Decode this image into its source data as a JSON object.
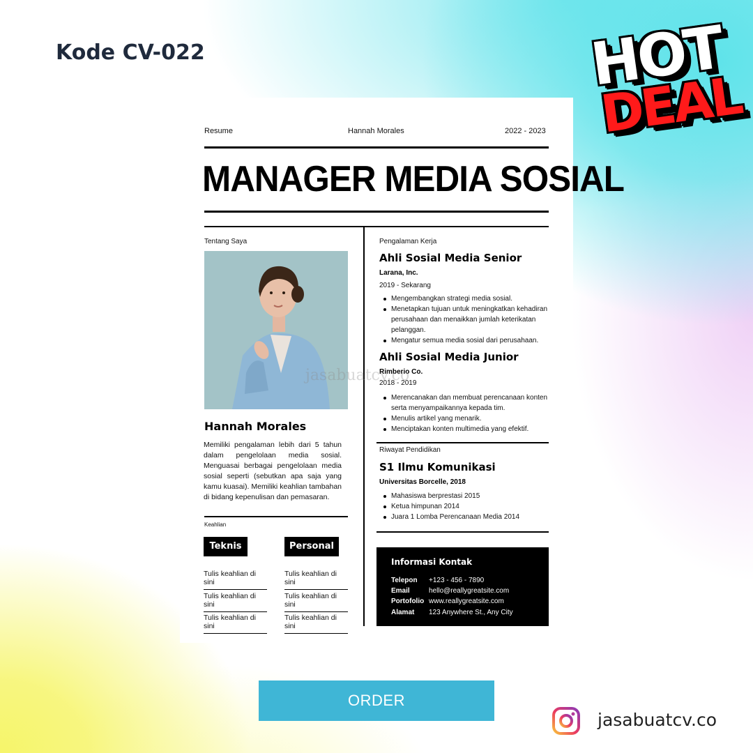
{
  "header": {
    "code": "Kode CV-022"
  },
  "badge": {
    "hot": "HOT",
    "deal": "DEAL"
  },
  "resume": {
    "top_left": "Resume",
    "top_center": "Hannah Morales",
    "top_right": "2022 - 2023",
    "title": "MANAGER MEDIA SOSIAL",
    "about_label": "Tentang Saya",
    "name": "Hannah Morales",
    "about_text": "Memiliki pengalaman lebih dari 5 tahun dalam pengelolaan media sosial. Menguasai berbagai pengelolaan media sosial seperti (sebutkan apa saja yang kamu kuasai). Memiliki keahlian tambahan di bidang kepenulisan dan pemasaran.",
    "skills_label": "Keahlian",
    "skills": {
      "technical_label": "Teknis",
      "personal_label": "Personal",
      "technical_items": [
        "Tulis keahlian di sini",
        "Tulis keahlian di sini",
        "Tulis keahlian di sini"
      ],
      "personal_items": [
        "Tulis keahlian di sini",
        "Tulis keahlian di sini",
        "Tulis keahlian di sini"
      ]
    },
    "experience_label": "Pengalaman Kerja",
    "jobs": [
      {
        "title": "Ahli Sosial Media Senior",
        "company": "Larana, Inc.",
        "period": "2019 - Sekarang",
        "bullets": [
          "Mengembangkan strategi media sosial.",
          "Menetapkan tujuan untuk meningkatkan kehadiran perusahaan dan menaikkan jumlah keterikatan pelanggan.",
          "Mengatur semua media sosial dari perusahaan."
        ]
      },
      {
        "title": "Ahli Sosial Media Junior",
        "company": "Rimberio Co.",
        "period": "2018 - 2019",
        "bullets": [
          "Merencanakan dan membuat perencanaan konten serta menyampaikannya kepada tim.",
          "Menulis artikel yang menarik.",
          "Menciptakan konten multimedia yang efektif."
        ]
      }
    ],
    "education_label": "Riwayat Pendidikan",
    "education": {
      "degree": "S1 Ilmu Komunikasi",
      "school": "Universitas Borcelle, 2018",
      "bullets": [
        "Mahasiswa berprestasi 2015",
        "Ketua himpunan 2014",
        "Juara 1 Lomba Perencanaan Media 2014"
      ]
    },
    "contact": {
      "title": "Informasi Kontak",
      "rows": [
        {
          "key": "Telepon",
          "value": "+123 - 456 - 7890"
        },
        {
          "key": "Email",
          "value": "hello@reallygreatsite.com"
        },
        {
          "key": "Portofolio",
          "value": "www.reallygreatsite.com"
        },
        {
          "key": "Alamat",
          "value": "123 Anywhere St., Any City"
        }
      ]
    },
    "watermark": "jasabuatcv.co"
  },
  "order": {
    "label": "ORDER"
  },
  "footer": {
    "handle": "jasabuatcv.co",
    "icon": "instagram-icon"
  },
  "colors": {
    "order_button": "#3fb6d6",
    "deal_red": "#ff1a1a",
    "code_text": "#1f2a3c"
  }
}
